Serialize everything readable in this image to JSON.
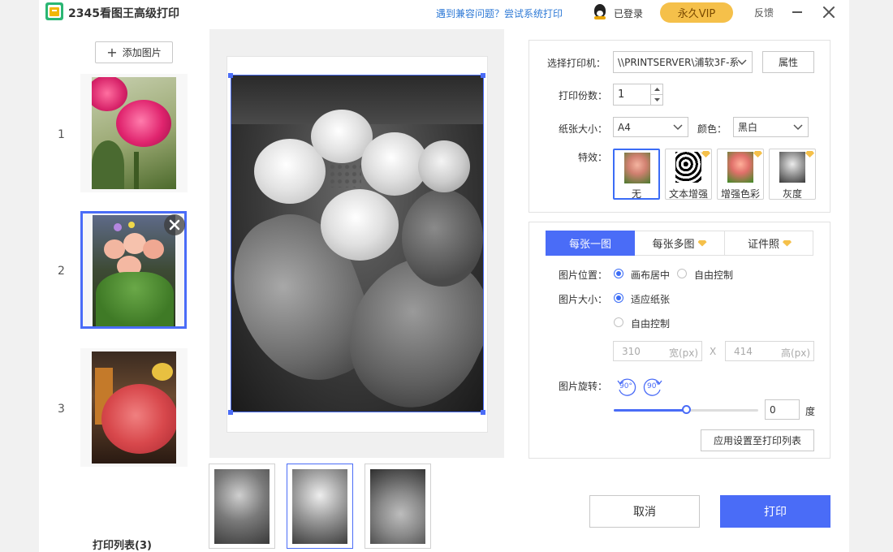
{
  "window": {
    "title": "2345看图王高级打印",
    "compat_link": "遇到兼容问题？尝试系统打印",
    "login_status": "已登录",
    "vip_label": "永久VIP",
    "feedback": "反馈"
  },
  "sidebar": {
    "add_button": "添加图片",
    "items": [
      {
        "index": "1"
      },
      {
        "index": "2"
      },
      {
        "index": "3"
      }
    ],
    "list_title": "打印列表(3)"
  },
  "settings": {
    "printer_label": "选择打印机：",
    "printer_value": "\\\\PRINTSERVER\\浦软3F-系",
    "properties_button": "属性",
    "copies_label": "打印份数：",
    "copies_value": "1",
    "paper_label": "纸张大小：",
    "paper_value": "A4",
    "color_label": "颜色：",
    "color_value": "黑白",
    "effects_label": "特效：",
    "effects": [
      {
        "label": "无",
        "selected": true,
        "vip": false
      },
      {
        "label": "文本增强",
        "selected": false,
        "vip": true
      },
      {
        "label": "增强色彩",
        "selected": false,
        "vip": true
      },
      {
        "label": "灰度",
        "selected": false,
        "vip": true
      }
    ]
  },
  "layout": {
    "tabs": [
      {
        "label": "每张一图",
        "active": true,
        "vip": false
      },
      {
        "label": "每张多图",
        "active": false,
        "vip": true
      },
      {
        "label": "证件照",
        "active": false,
        "vip": true
      }
    ],
    "position_label": "图片位置：",
    "position_options": [
      "画布居中",
      "自由控制"
    ],
    "size_label": "图片大小：",
    "size_options": [
      "适应纸张",
      "自由控制"
    ],
    "width_value": "310",
    "width_unit": "宽(px)",
    "times": "X",
    "height_value": "414",
    "height_unit": "高(px)",
    "rotate_label": "图片旋转：",
    "rotate_ccw": "90°",
    "rotate_cw": "90°",
    "rotation_value": "0",
    "rotation_slider_fraction": 0.5,
    "degree_unit": "度",
    "apply_button": "应用设置至打印列表"
  },
  "actions": {
    "cancel": "取消",
    "print": "打印"
  },
  "colors": {
    "accent": "#4a6cf7",
    "vip_gold": "#f5c04a",
    "link": "#2f7ad6"
  }
}
